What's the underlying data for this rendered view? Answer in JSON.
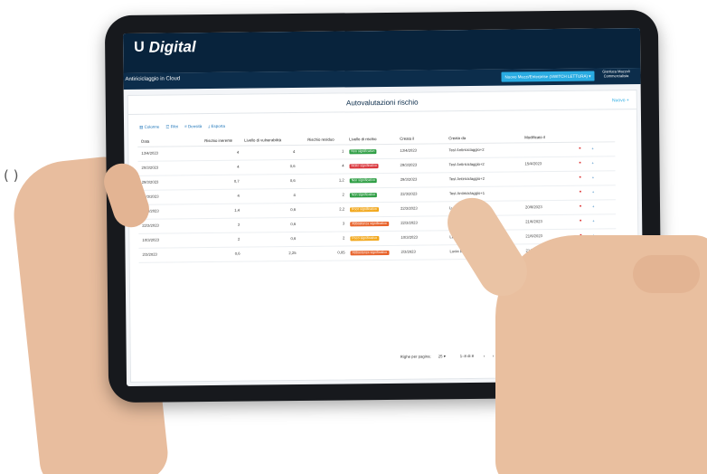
{
  "edge_glyphs": "( )",
  "brand": {
    "logo_mark": "U",
    "name": "Digital"
  },
  "appbar": {
    "title": "Antiriciclaggio in Cloud",
    "company_select": "Nuovo Mezzi/Enterprise (SWITCH LETTURA) ▾",
    "user_name": "Gianluca Mazzoli",
    "user_role": "Commercialista"
  },
  "page": {
    "title": "Autovalutazioni rischio",
    "new_button": "Nuovo +"
  },
  "toolbar": {
    "columns": "▥ Colonne",
    "filters": "☲ Filtri",
    "density": "≡ Densità",
    "export": "⤓ Esporta"
  },
  "table": {
    "columns": [
      "Data",
      "Rischio inerente",
      "Livello di vulnerabilità",
      "Rischio residuo",
      "Livello di rischio",
      "Creato il",
      "Creato da",
      "Modificato il"
    ],
    "rows": [
      {
        "data": "13/4/2023",
        "ri": "4",
        "vul": "4",
        "res": "1",
        "liv": "Non significativo",
        "col": "#2e9e44",
        "cre": "13/4/2023",
        "by": "Test Antiriciclaggio+2",
        "mod": ""
      },
      {
        "data": "20/3/2023",
        "ri": "4",
        "vul": "0,6",
        "res": "4",
        "liv": "Molto significativo",
        "col": "#d9343a",
        "cre": "29/3/2023",
        "by": "Test Antiriciclaggio+2",
        "mod": "15/4/2023"
      },
      {
        "data": "29/3/2023",
        "ri": "0,7",
        "vul": "0,6",
        "res": "1,2",
        "liv": "Non significativo",
        "col": "#2e9e44",
        "cre": "29/3/2023",
        "by": "Test Antiriciclaggio+2",
        "mod": ""
      },
      {
        "data": "22/3/2023",
        "ri": "4",
        "vul": "4",
        "res": "2",
        "liv": "Non significativo",
        "col": "#2e9e44",
        "cre": "22/3/2023",
        "by": "Test Antiriciclaggio+1",
        "mod": ""
      },
      {
        "data": "22/3/2023",
        "ri": "1,4",
        "vul": "0,6",
        "res": "2,2",
        "liv": "Poco significativo",
        "col": "#f2a81d",
        "cre": "22/3/2023",
        "by": "Lucia Dolci",
        "mod": "20/6/2023"
      },
      {
        "data": "22/3/2023",
        "ri": "3",
        "vul": "0,6",
        "res": "3",
        "liv": "Abbastanza significativo",
        "col": "#e8632b",
        "cre": "22/3/2023",
        "by": "Lucia D",
        "mod": "21/6/2023"
      },
      {
        "data": "10/3/2023",
        "ri": "2",
        "vul": "0,6",
        "res": "2",
        "liv": "Poco significativo",
        "col": "#f2a81d",
        "cre": "10/3/2023",
        "by": "Lucia D",
        "mod": "21/6/2023"
      },
      {
        "data": "2/3/2023",
        "ri": "0,6",
        "vul": "2,25",
        "res": "0,05",
        "liv": "Abbastanza significativo",
        "col": "#e8632b",
        "cre": "2/3/2023",
        "by": "Lucia Dolci",
        "mod": "21/6/2023"
      }
    ]
  },
  "footer": {
    "rows_per_page_label": "Righe per pagina:",
    "rows_per_page_value": "25 ▾",
    "range": "1–8 di 8",
    "prev": "‹",
    "next": "›"
  }
}
